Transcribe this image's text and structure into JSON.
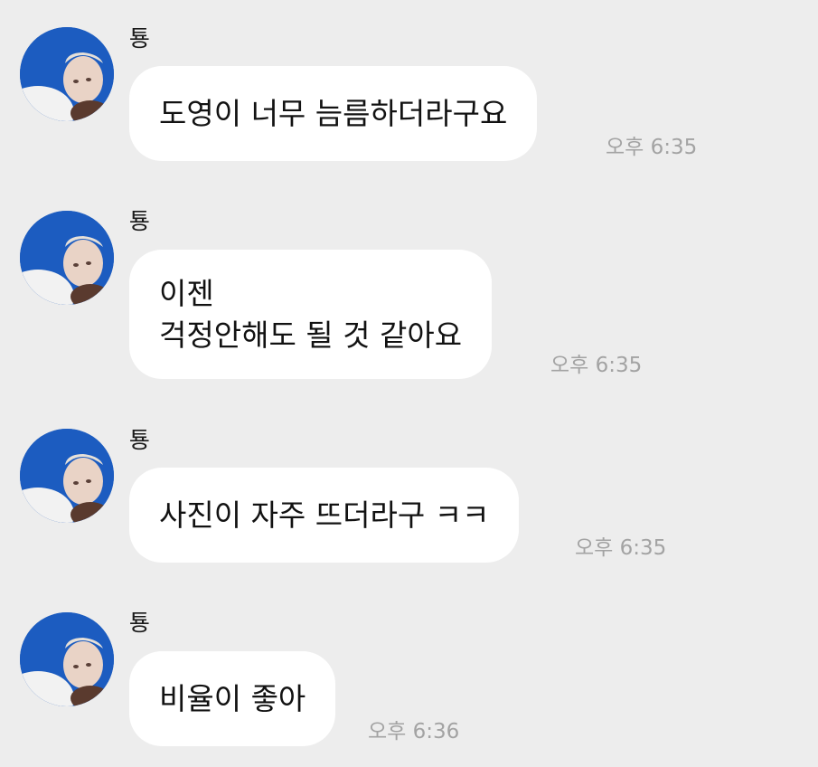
{
  "messages": [
    {
      "sender": "툥",
      "lines": [
        "도영이 너무 늠름하더라구요"
      ],
      "time": "오후 6:35"
    },
    {
      "sender": "툥",
      "lines": [
        "이젠",
        "걱정안해도 될 것 같아요"
      ],
      "time": "오후 6:35"
    },
    {
      "sender": "툥",
      "lines": [
        "사진이 자주 뜨더라구 ㅋㅋ"
      ],
      "time": "오후 6:35"
    },
    {
      "sender": "툥",
      "lines": [
        "비율이 좋아"
      ],
      "time": "오후 6:36"
    }
  ],
  "colors": {
    "background": "#ededed",
    "bubble": "#ffffff",
    "timestamp": "#a3a3a3",
    "avatar_sky": "#1a55b8"
  },
  "icons": {
    "avatar": "profile-photo-avatar-icon"
  }
}
